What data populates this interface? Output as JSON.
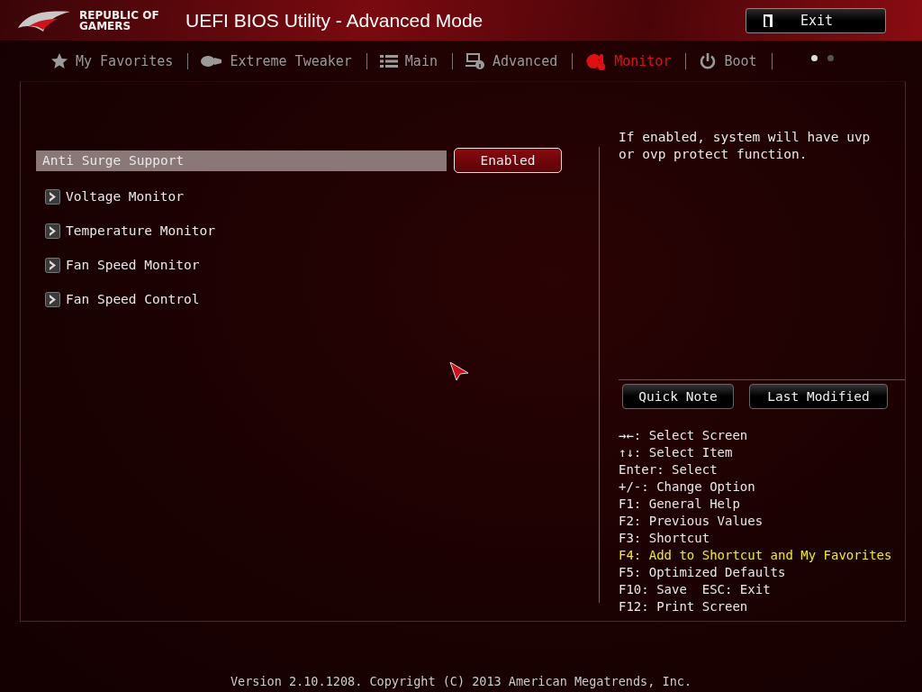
{
  "header": {
    "logo_text": "REPUBLIC OF GAMERS",
    "title": "UEFI BIOS Utility - Advanced Mode",
    "exit_button": "Exit"
  },
  "tabs": [
    {
      "label": "My Favorites",
      "kind": "favorites",
      "selected": false
    },
    {
      "label": "Extreme Tweaker",
      "kind": "tweaker",
      "selected": false
    },
    {
      "label": "Main",
      "kind": "main",
      "selected": false
    },
    {
      "label": "Advanced",
      "kind": "advanced",
      "selected": false
    },
    {
      "label": "Monitor",
      "kind": "monitor",
      "selected": true
    },
    {
      "label": "Boot",
      "kind": "boot",
      "selected": false
    }
  ],
  "pages": [
    {
      "selected": true
    },
    {
      "selected": false
    }
  ],
  "items": [
    {
      "kind": "setting",
      "label": "Anti Surge Support",
      "value": "Enabled",
      "selected": true
    },
    {
      "kind": "submenu",
      "label": "Voltage Monitor",
      "selected": false
    },
    {
      "kind": "submenu",
      "label": "Temperature Monitor",
      "selected": false
    },
    {
      "kind": "submenu",
      "label": "Fan Speed Monitor",
      "selected": false
    },
    {
      "kind": "submenu",
      "label": "Fan Speed Control",
      "selected": false
    }
  ],
  "help_text": "If enabled, system will have uvp or ovp protect function.",
  "buttons": [
    "Quick Note",
    "Last Modified"
  ],
  "keys": [
    {
      "text": "→←: Select Screen",
      "highlight": false
    },
    {
      "text": "↑↓: Select Item",
      "highlight": false
    },
    {
      "text": "Enter: Select",
      "highlight": false
    },
    {
      "text": "+/-: Change Option",
      "highlight": false
    },
    {
      "text": "F1: General Help",
      "highlight": false
    },
    {
      "text": "F2: Previous Values",
      "highlight": false
    },
    {
      "text": "F3: Shortcut",
      "highlight": false
    },
    {
      "text": "F4: Add to Shortcut and My Favorites",
      "highlight": true
    },
    {
      "text": "F5: Optimized Defaults",
      "highlight": false
    },
    {
      "text": "F10: Save  ESC: Exit",
      "highlight": false
    },
    {
      "text": "F12: Print Screen",
      "highlight": false
    }
  ],
  "footer": "Version 2.10.1208. Copyright (C) 2013 American Megatrends, Inc."
}
